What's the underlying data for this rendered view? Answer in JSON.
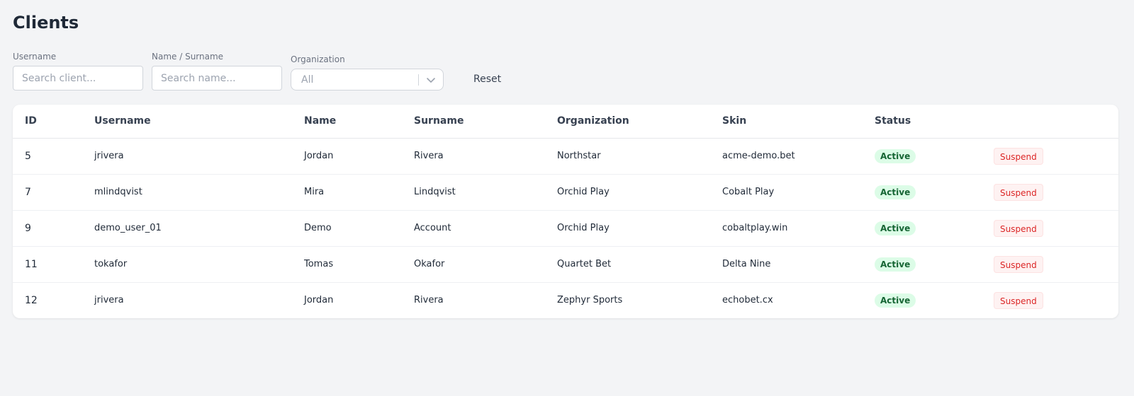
{
  "page": {
    "title": "Clients"
  },
  "filters": {
    "username": {
      "label": "Username",
      "placeholder": "Search client...",
      "value": ""
    },
    "name_surname": {
      "label": "Name / Surname",
      "placeholder": "Search name...",
      "value": ""
    },
    "organization": {
      "label": "Organization",
      "selected": "All"
    },
    "reset_label": "Reset"
  },
  "table": {
    "columns": [
      "ID",
      "Username",
      "Name",
      "Surname",
      "Organization",
      "Skin",
      "Status",
      ""
    ],
    "rows": [
      {
        "id": "5",
        "username": "jrivera",
        "name": "Jordan",
        "surname": "Rivera",
        "organization": "Northstar",
        "skin": "acme-demo.bet",
        "status": "Active",
        "action": "Suspend"
      },
      {
        "id": "7",
        "username": "mlindqvist",
        "name": "Mira",
        "surname": "Lindqvist",
        "organization": "Orchid Play",
        "skin": "Cobalt Play",
        "status": "Active",
        "action": "Suspend"
      },
      {
        "id": "9",
        "username": "demo_user_01",
        "name": "Demo",
        "surname": "Account",
        "organization": "Orchid Play",
        "skin": "cobaltplay.win",
        "status": "Active",
        "action": "Suspend"
      },
      {
        "id": "11",
        "username": "tokafor",
        "name": "Tomas",
        "surname": "Okafor",
        "organization": "Quartet Bet",
        "skin": "Delta Nine",
        "status": "Active",
        "action": "Suspend"
      },
      {
        "id": "12",
        "username": "jrivera",
        "name": "Jordan",
        "surname": "Rivera",
        "organization": "Zephyr Sports",
        "skin": "echobet.cx",
        "status": "Active",
        "action": "Suspend"
      }
    ]
  },
  "colors": {
    "background": "#f3f4f6",
    "status_active_bg": "#dcfce7",
    "status_active_text": "#166534",
    "suspend_text": "#dc2626",
    "suspend_bg": "#fef2f2"
  },
  "icons": {
    "organization_select": "chevron-down-icon"
  }
}
